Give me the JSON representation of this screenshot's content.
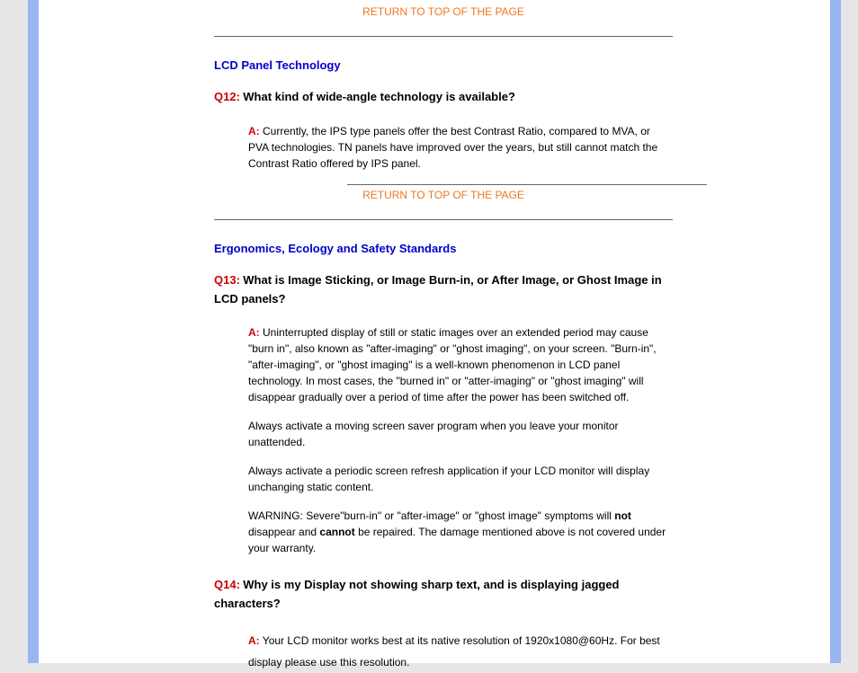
{
  "return_link": "RETURN TO TOP OF THE PAGE",
  "section1": {
    "heading": "LCD Panel Technology",
    "q12": {
      "label": "Q12:",
      "text": "What kind of wide-angle technology is available?",
      "a_label": "A:",
      "answer": "Currently, the IPS type panels offer the best Contrast Ratio, compared to MVA, or PVA technologies.  TN panels have improved over the years, but still cannot match the Contrast Ratio offered by IPS panel."
    }
  },
  "section2": {
    "heading": "Ergonomics, Ecology and Safety Standards",
    "q13": {
      "label": "Q13:",
      "text": "What is Image Sticking, or Image Burn-in, or After Image, or Ghost Image in LCD panels?",
      "a_label": "A:",
      "answer": "Uninterrupted display of still or static images over an extended period may cause \"burn in\", also known as \"after-imaging\" or \"ghost imaging\", on your screen. \"Burn-in\", \"after-imaging\", or \"ghost imaging\" is a well-known phenomenon in LCD panel technology. In most cases, the \"burned in\" or \"atter-imaging\" or \"ghost imaging\" will disappear gradually over a period of time after the power has been switched off.",
      "p2": "Always activate a moving screen saver program when you leave your monitor unattended.",
      "p3": "Always activate a periodic screen refresh application if your LCD monitor will display unchanging static content.",
      "warn1": "WARNING: Severe\"burn-in\" or \"after-image\" or \"ghost image\" symptoms will ",
      "warn_not": "not",
      "warn2": " disappear and ",
      "warn_cannot": "cannot",
      "warn3": " be repaired. The damage mentioned above is not covered under your warranty."
    },
    "q14": {
      "label": "Q14:",
      "text": "Why is my Display not showing sharp text, and is displaying jagged characters?",
      "a_label": "A:",
      "answer": "Your LCD monitor works best at its native resolution of 1920x1080@60Hz. For best display please use this resolution."
    }
  }
}
